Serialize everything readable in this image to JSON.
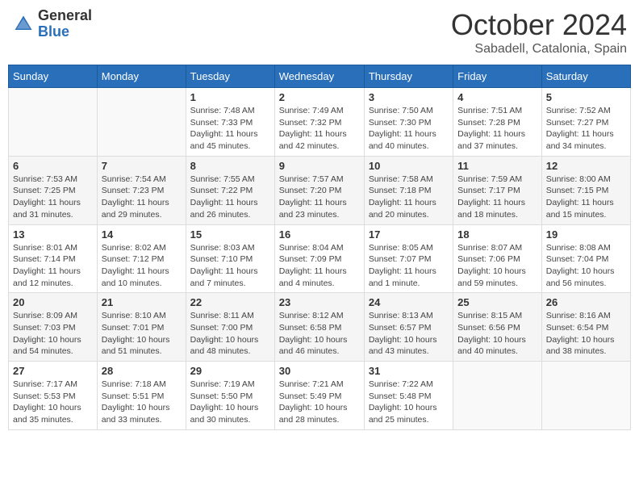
{
  "header": {
    "logo_general": "General",
    "logo_blue": "Blue",
    "month_title": "October 2024",
    "subtitle": "Sabadell, Catalonia, Spain"
  },
  "days_of_week": [
    "Sunday",
    "Monday",
    "Tuesday",
    "Wednesday",
    "Thursday",
    "Friday",
    "Saturday"
  ],
  "weeks": [
    [
      {
        "day": "",
        "info": ""
      },
      {
        "day": "",
        "info": ""
      },
      {
        "day": "1",
        "info": "Sunrise: 7:48 AM\nSunset: 7:33 PM\nDaylight: 11 hours and 45 minutes."
      },
      {
        "day": "2",
        "info": "Sunrise: 7:49 AM\nSunset: 7:32 PM\nDaylight: 11 hours and 42 minutes."
      },
      {
        "day": "3",
        "info": "Sunrise: 7:50 AM\nSunset: 7:30 PM\nDaylight: 11 hours and 40 minutes."
      },
      {
        "day": "4",
        "info": "Sunrise: 7:51 AM\nSunset: 7:28 PM\nDaylight: 11 hours and 37 minutes."
      },
      {
        "day": "5",
        "info": "Sunrise: 7:52 AM\nSunset: 7:27 PM\nDaylight: 11 hours and 34 minutes."
      }
    ],
    [
      {
        "day": "6",
        "info": "Sunrise: 7:53 AM\nSunset: 7:25 PM\nDaylight: 11 hours and 31 minutes."
      },
      {
        "day": "7",
        "info": "Sunrise: 7:54 AM\nSunset: 7:23 PM\nDaylight: 11 hours and 29 minutes."
      },
      {
        "day": "8",
        "info": "Sunrise: 7:55 AM\nSunset: 7:22 PM\nDaylight: 11 hours and 26 minutes."
      },
      {
        "day": "9",
        "info": "Sunrise: 7:57 AM\nSunset: 7:20 PM\nDaylight: 11 hours and 23 minutes."
      },
      {
        "day": "10",
        "info": "Sunrise: 7:58 AM\nSunset: 7:18 PM\nDaylight: 11 hours and 20 minutes."
      },
      {
        "day": "11",
        "info": "Sunrise: 7:59 AM\nSunset: 7:17 PM\nDaylight: 11 hours and 18 minutes."
      },
      {
        "day": "12",
        "info": "Sunrise: 8:00 AM\nSunset: 7:15 PM\nDaylight: 11 hours and 15 minutes."
      }
    ],
    [
      {
        "day": "13",
        "info": "Sunrise: 8:01 AM\nSunset: 7:14 PM\nDaylight: 11 hours and 12 minutes."
      },
      {
        "day": "14",
        "info": "Sunrise: 8:02 AM\nSunset: 7:12 PM\nDaylight: 11 hours and 10 minutes."
      },
      {
        "day": "15",
        "info": "Sunrise: 8:03 AM\nSunset: 7:10 PM\nDaylight: 11 hours and 7 minutes."
      },
      {
        "day": "16",
        "info": "Sunrise: 8:04 AM\nSunset: 7:09 PM\nDaylight: 11 hours and 4 minutes."
      },
      {
        "day": "17",
        "info": "Sunrise: 8:05 AM\nSunset: 7:07 PM\nDaylight: 11 hours and 1 minute."
      },
      {
        "day": "18",
        "info": "Sunrise: 8:07 AM\nSunset: 7:06 PM\nDaylight: 10 hours and 59 minutes."
      },
      {
        "day": "19",
        "info": "Sunrise: 8:08 AM\nSunset: 7:04 PM\nDaylight: 10 hours and 56 minutes."
      }
    ],
    [
      {
        "day": "20",
        "info": "Sunrise: 8:09 AM\nSunset: 7:03 PM\nDaylight: 10 hours and 54 minutes."
      },
      {
        "day": "21",
        "info": "Sunrise: 8:10 AM\nSunset: 7:01 PM\nDaylight: 10 hours and 51 minutes."
      },
      {
        "day": "22",
        "info": "Sunrise: 8:11 AM\nSunset: 7:00 PM\nDaylight: 10 hours and 48 minutes."
      },
      {
        "day": "23",
        "info": "Sunrise: 8:12 AM\nSunset: 6:58 PM\nDaylight: 10 hours and 46 minutes."
      },
      {
        "day": "24",
        "info": "Sunrise: 8:13 AM\nSunset: 6:57 PM\nDaylight: 10 hours and 43 minutes."
      },
      {
        "day": "25",
        "info": "Sunrise: 8:15 AM\nSunset: 6:56 PM\nDaylight: 10 hours and 40 minutes."
      },
      {
        "day": "26",
        "info": "Sunrise: 8:16 AM\nSunset: 6:54 PM\nDaylight: 10 hours and 38 minutes."
      }
    ],
    [
      {
        "day": "27",
        "info": "Sunrise: 7:17 AM\nSunset: 5:53 PM\nDaylight: 10 hours and 35 minutes."
      },
      {
        "day": "28",
        "info": "Sunrise: 7:18 AM\nSunset: 5:51 PM\nDaylight: 10 hours and 33 minutes."
      },
      {
        "day": "29",
        "info": "Sunrise: 7:19 AM\nSunset: 5:50 PM\nDaylight: 10 hours and 30 minutes."
      },
      {
        "day": "30",
        "info": "Sunrise: 7:21 AM\nSunset: 5:49 PM\nDaylight: 10 hours and 28 minutes."
      },
      {
        "day": "31",
        "info": "Sunrise: 7:22 AM\nSunset: 5:48 PM\nDaylight: 10 hours and 25 minutes."
      },
      {
        "day": "",
        "info": ""
      },
      {
        "day": "",
        "info": ""
      }
    ]
  ]
}
